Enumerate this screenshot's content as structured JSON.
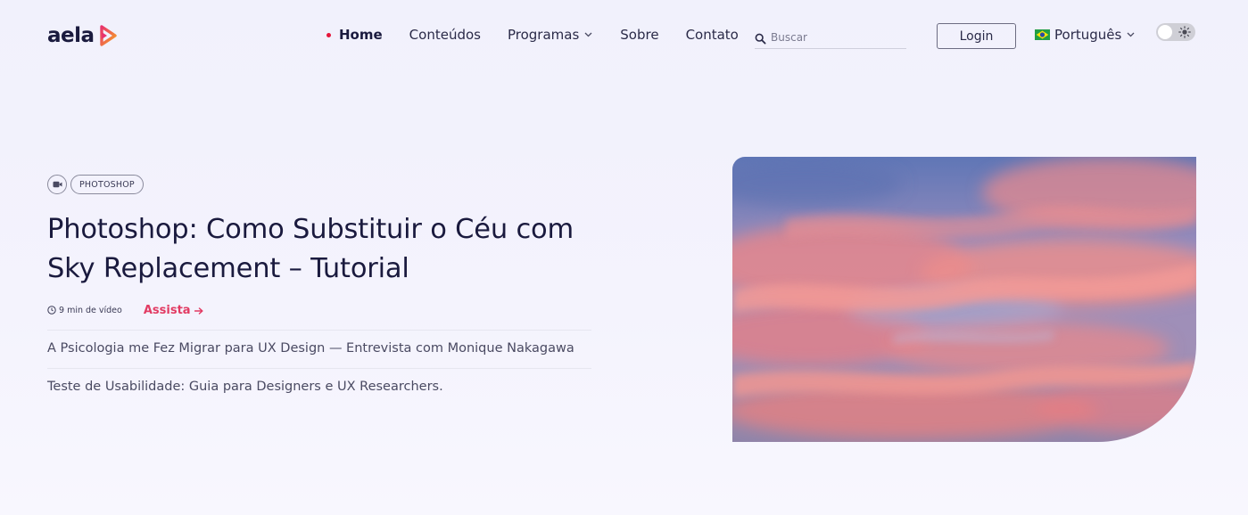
{
  "header": {
    "logo_text": "aela",
    "nav": [
      {
        "label": "Home",
        "active": true
      },
      {
        "label": "Conteúdos"
      },
      {
        "label": "Programas",
        "has_dropdown": true
      },
      {
        "label": "Sobre"
      },
      {
        "label": "Contato"
      }
    ],
    "search": {
      "placeholder": "Buscar",
      "value": ""
    },
    "login_label": "Login",
    "language": {
      "selected": "Português",
      "flag": "brazil-flag"
    },
    "theme_toggle": {
      "state": "light",
      "icon": "sun-icon"
    }
  },
  "hero": {
    "media_type_icon": "video-camera-icon",
    "category_tag": "PHOTOSHOP",
    "title": "Photoshop: Como Substituir o Céu com Sky Replacement – Tutorial",
    "duration": "9 min de vídeo",
    "watch_label": "Assista",
    "image_description_icon": "sunset-sky-image"
  },
  "related_articles": [
    {
      "title": "A Psicologia me Fez Migrar para UX Design — Entrevista com Monique Nakagawa"
    },
    {
      "title": "Teste de Usabilidade: Guia para Designers e UX Researchers."
    }
  ],
  "colors": {
    "accent": "#e23b63",
    "active_dot": "#e5153a",
    "text_dark": "#1a1a3e",
    "background": "#f2f1fc",
    "logo_gradient_start": "#e8336d",
    "logo_gradient_end": "#f6a623"
  }
}
